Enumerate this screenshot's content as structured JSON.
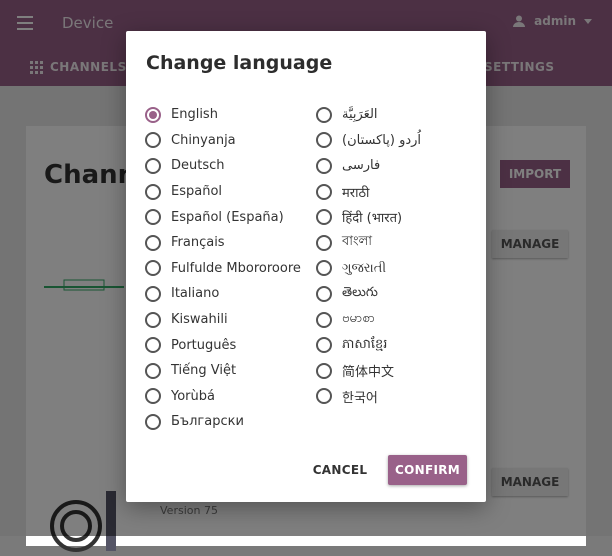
{
  "app": {
    "title": "Device",
    "user": "admin",
    "tabs": {
      "channels": "CHANNELS",
      "settings": "SETTINGS"
    }
  },
  "page": {
    "heading": "Chann",
    "import_label": "IMPORT",
    "manage_label": "MANAGE",
    "version_text": "Version 75"
  },
  "modal": {
    "title": "Change language",
    "selected": "English",
    "languages_col1": [
      "English",
      "Chinyanja",
      "Deutsch",
      "Español",
      "Español (España)",
      "Français",
      "Fulfulde Mbororoore",
      "Italiano",
      "Kiswahili",
      "Português",
      "Tiếng Việt",
      "Yorùbá",
      "Български"
    ],
    "languages_col2": [
      "العَرَبِيَّة",
      "اُردو (پاکستان)",
      "فارسی",
      "मराठी",
      "हिंदी (भारत)",
      "বাংলা",
      "ગુજરાતી",
      "తెలుగు",
      "ဗမာစာ",
      "ភាសាខ្មែរ",
      "简体中文",
      "한국어"
    ],
    "cancel_label": "CANCEL",
    "confirm_label": "CONFIRM"
  },
  "colors": {
    "accent": "#996189",
    "overlay": "rgba(0,0,0,0.5)"
  }
}
